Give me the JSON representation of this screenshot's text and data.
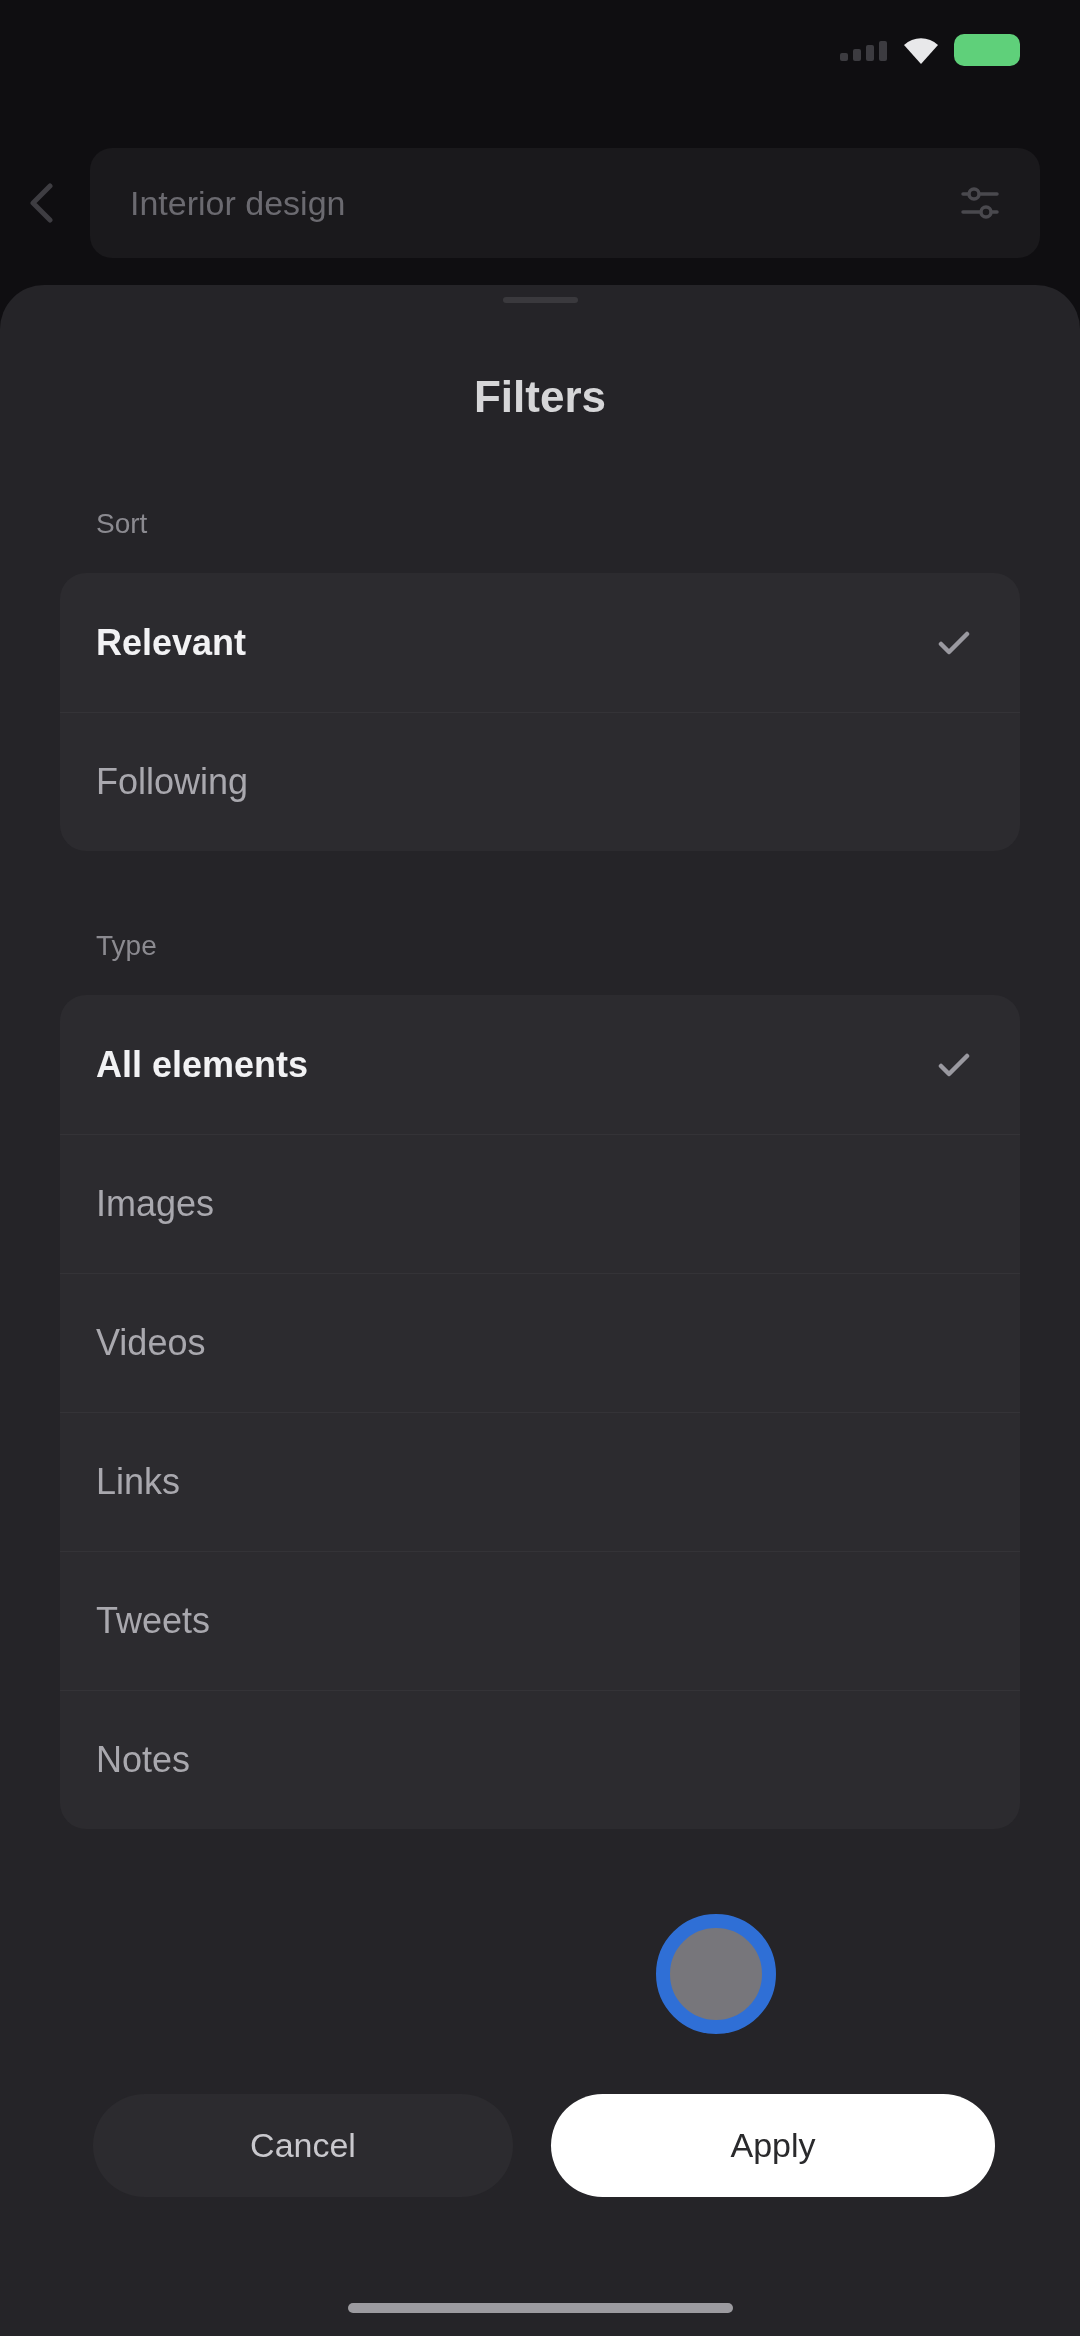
{
  "search": {
    "value": "Interior design"
  },
  "sheet": {
    "title": "Filters",
    "sections": [
      {
        "label": "Sort",
        "options": [
          {
            "label": "Relevant",
            "selected": true
          },
          {
            "label": "Following",
            "selected": false
          }
        ]
      },
      {
        "label": "Type",
        "options": [
          {
            "label": "All elements",
            "selected": true
          },
          {
            "label": "Images",
            "selected": false
          },
          {
            "label": "Videos",
            "selected": false
          },
          {
            "label": "Links",
            "selected": false
          },
          {
            "label": "Tweets",
            "selected": false
          },
          {
            "label": "Notes",
            "selected": false
          }
        ]
      }
    ]
  },
  "buttons": [
    {
      "label": "Cancel",
      "kind": "secondary"
    },
    {
      "label": "Apply",
      "kind": "primary"
    }
  ]
}
